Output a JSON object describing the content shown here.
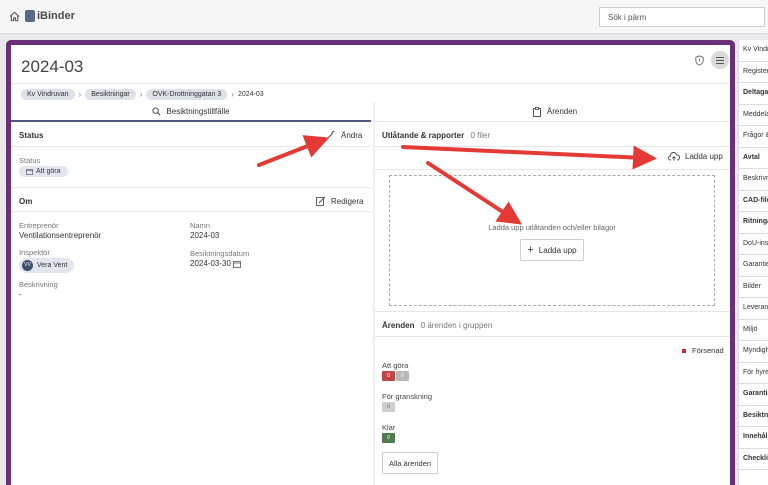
{
  "topbar": {
    "logo_text": "iBinder",
    "search_placeholder": "Sök i pärm"
  },
  "page": {
    "title": "2024-03",
    "breadcrumb": [
      "Kv Vindruvan",
      "Besiktningar",
      "OVK-Drottninggatan 3",
      "2024-03"
    ]
  },
  "left": {
    "tab_label": "Besiktningstillfälle",
    "status_section": {
      "heading": "Status",
      "action": "Ändra",
      "field_label": "Status",
      "field_value": "Att göra"
    },
    "om_section": {
      "heading": "Om",
      "action": "Redigera",
      "entreprenor_label": "Entreprenör",
      "entreprenor_value": "Ventilationsentreprenör",
      "namn_label": "Namn",
      "namn_value": "2024-03",
      "inspektor_label": "Inspektör",
      "inspektor_initials": "VV",
      "inspektor_value": "Vera Vent",
      "datum_label": "Besiktningsdatum",
      "datum_value": "2024-03-30",
      "beskrivning_label": "Beskrivning",
      "beskrivning_value": "-"
    }
  },
  "right": {
    "tab_label": "Ärenden",
    "reports": {
      "heading": "Utlåtande & rapporter",
      "count": "0 filer",
      "upload_top": "Ladda upp",
      "hint": "Ladda upp utlåtanden och/eller bilagor",
      "upload_button": "Ladda upp"
    },
    "arenden": {
      "heading": "Ärenden",
      "count": "0 ärenden i gruppen",
      "legend": "Försenad",
      "groups": [
        {
          "label": "Att göra",
          "chips": [
            "0",
            "0"
          ]
        },
        {
          "label": "För granskning",
          "chips": [
            "0"
          ]
        },
        {
          "label": "Klar",
          "chips": [
            "0"
          ]
        }
      ],
      "all_button": "Alla ärenden"
    }
  },
  "sidebar": {
    "items": [
      {
        "label": "Kv Vindruvan",
        "bold": false
      },
      {
        "label": "Register",
        "bold": false
      },
      {
        "label": "Deltagare",
        "bold": true
      },
      {
        "label": "Meddelanden",
        "bold": false
      },
      {
        "label": "Frågor & svar",
        "bold": false
      },
      {
        "label": "Avtal",
        "bold": true
      },
      {
        "label": "Beskrivningar",
        "bold": false
      },
      {
        "label": "CAD-filer",
        "bold": true
      },
      {
        "label": "Ritningar",
        "bold": true
      },
      {
        "label": "DoU-instruktioner",
        "bold": false
      },
      {
        "label": "Garantier",
        "bold": false
      },
      {
        "label": "Bilder",
        "bold": false
      },
      {
        "label": "Leveranser",
        "bold": false
      },
      {
        "label": "Miljö",
        "bold": false
      },
      {
        "label": "Myndigheter",
        "bold": false
      },
      {
        "label": "För hyresgäster",
        "bold": false
      },
      {
        "label": "Garantier",
        "bold": true
      },
      {
        "label": "Besiktningar",
        "bold": true
      },
      {
        "label": "Innehåll",
        "bold": true
      },
      {
        "label": "Checklistor till förvaltning",
        "bold": true
      }
    ]
  },
  "colors": {
    "frame": "#6b2f78",
    "arrow": "#e53935",
    "chip_red": "#c44747",
    "chip_grey": "#b8b8b8",
    "chip_green": "#4f7a4f"
  }
}
